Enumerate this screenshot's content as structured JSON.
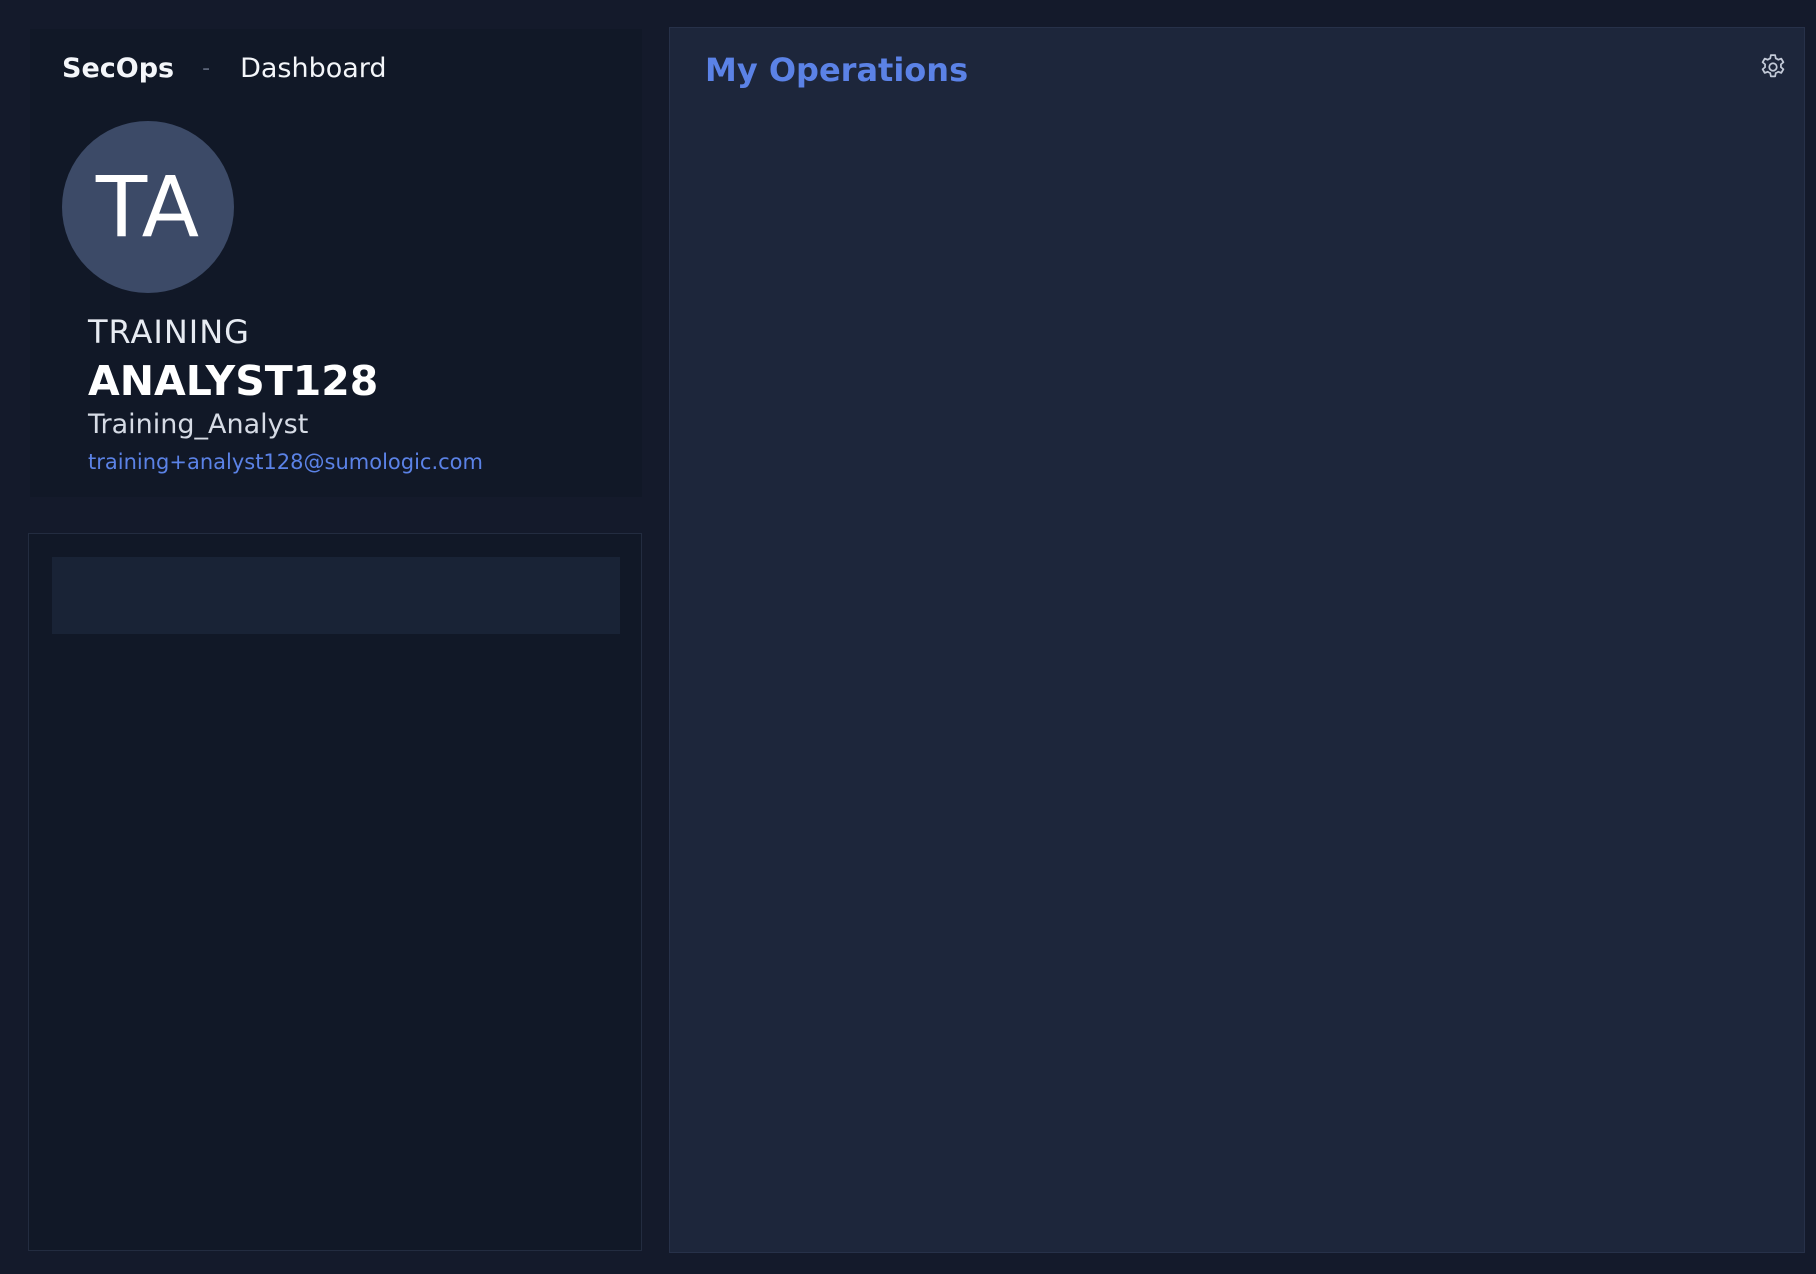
{
  "breadcrumb": {
    "app": "SecOps",
    "separator": "-",
    "page": "Dashboard"
  },
  "profile": {
    "initials": "TA",
    "first_name": "TRAINING",
    "last_name": "ANALYST128",
    "role": "Training_Analyst",
    "email": "training+analyst128@sumologic.com"
  },
  "operations": {
    "title": "My Operations",
    "settings_icon": "gear-icon"
  },
  "colors": {
    "background": "#141a2b",
    "card": "#111827",
    "panel": "#1d263b",
    "accent": "#5b82e6",
    "avatar": "#3c4a67"
  }
}
